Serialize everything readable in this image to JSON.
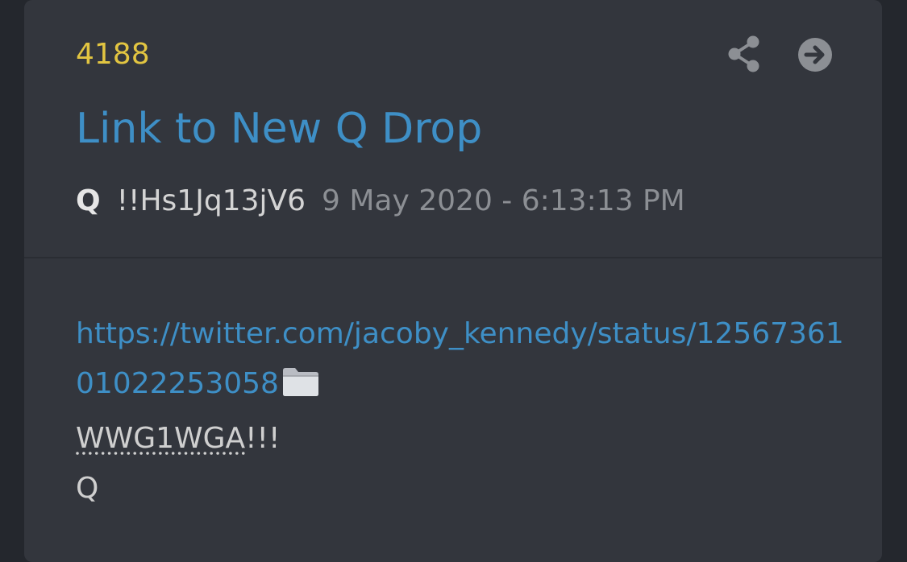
{
  "post": {
    "number": "4188",
    "title": "Link to New Q Drop",
    "author": "Q",
    "tripcode": "!!Hs1Jq13jV6",
    "date": "9 May 2020 - 6:13:13 PM",
    "link": "https://twitter.com/jacoby_kennedy/status/1256736101022253058",
    "tag_text": "WWG1WGA",
    "tag_suffix": "!!!",
    "signature": "Q"
  },
  "icons": {
    "share": "share-icon",
    "goto": "arrow-circle-right-icon",
    "folder": "folder-icon"
  },
  "colors": {
    "number": "#e2c541",
    "link": "#3e8fc6",
    "card": "#33363d",
    "background": "#24272d"
  }
}
